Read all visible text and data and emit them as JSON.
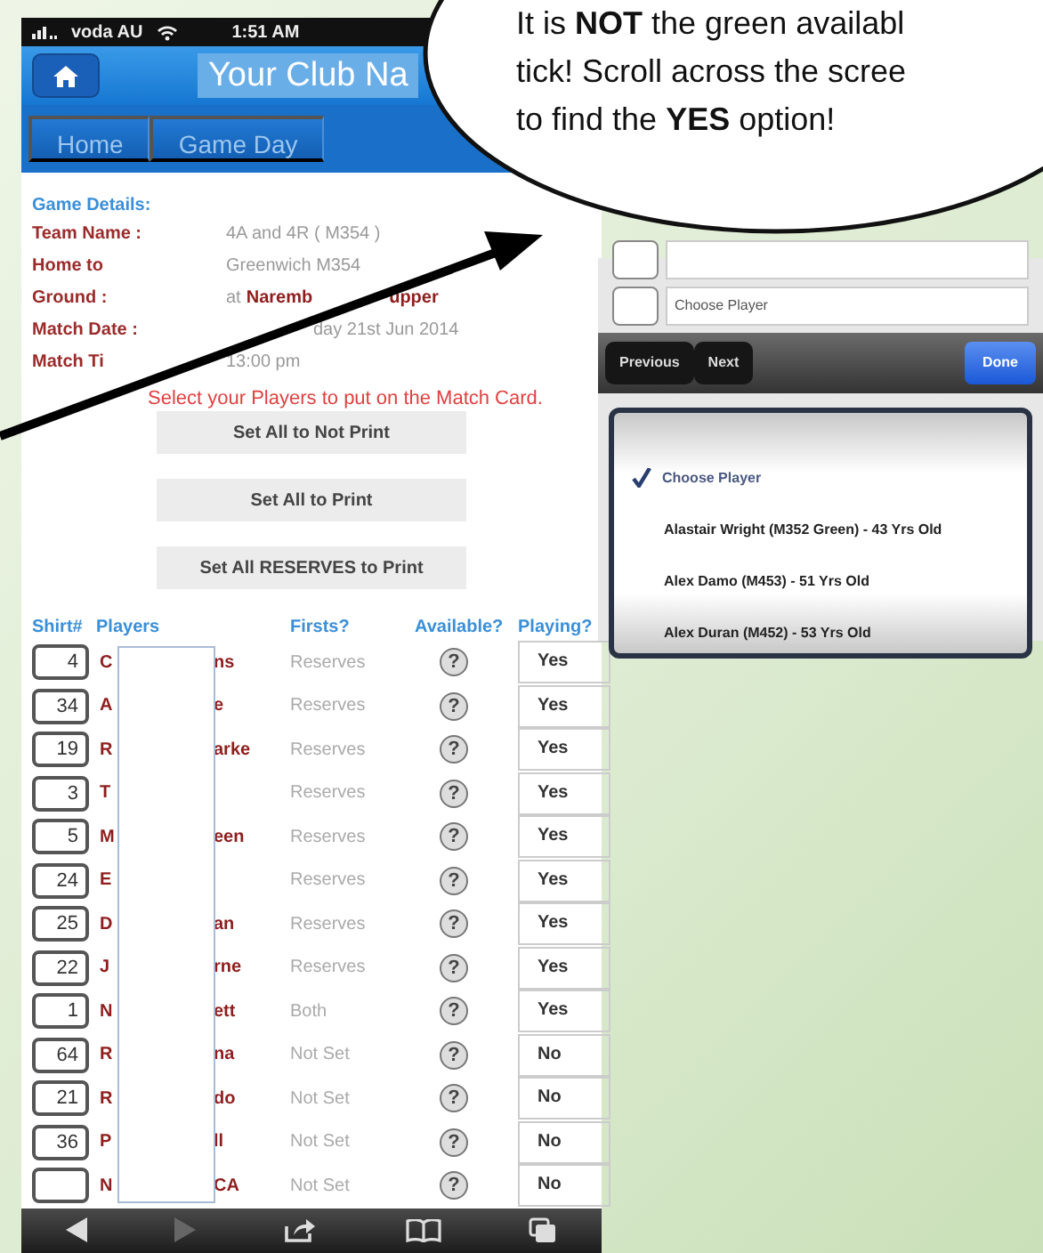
{
  "status_bar": {
    "carrier": "voda AU",
    "time": "1:51 AM"
  },
  "header": {
    "title": "Your Club Na"
  },
  "tabs": [
    {
      "label": "Home"
    },
    {
      "label": "Game Day"
    }
  ],
  "game_details": {
    "heading": "Game Details:",
    "rows": [
      {
        "label": "Team Name :",
        "pieces": [
          {
            "text": "4A and 4R ( M354 )",
            "strong": false
          }
        ]
      },
      {
        "label": "Home to",
        "pieces": [
          {
            "text": "Greenwich M354",
            "strong": false
          }
        ]
      },
      {
        "label": "Ground :",
        "pieces": [
          {
            "text": "at",
            "strong": false
          },
          {
            "text": "Naremb",
            "strong": true
          },
          {
            "text": "upper",
            "strong": true
          }
        ]
      },
      {
        "label": "Match Date :",
        "pieces": [
          {
            "text": "day 21st Jun 2014",
            "strong": false
          }
        ]
      },
      {
        "label": "Match Ti",
        "pieces": [
          {
            "text": "13:00 pm",
            "strong": false
          }
        ]
      }
    ],
    "notice": "Select your Players to put on the Match Card."
  },
  "buttons": [
    "Set All to Not Print",
    "Set All to Print",
    "Set All **RESERVES** to Print"
  ],
  "table": {
    "columns": [
      "Shirt#",
      "Players",
      "Firsts?",
      "Available?",
      "Playing?"
    ],
    "rows": [
      {
        "shirt": "4",
        "name_start": "C",
        "name_end": "ns",
        "firsts": "Reserves",
        "available": "?",
        "playing": "Yes"
      },
      {
        "shirt": "34",
        "name_start": "A",
        "name_end": "e",
        "firsts": "Reserves",
        "available": "?",
        "playing": "Yes"
      },
      {
        "shirt": "19",
        "name_start": "R",
        "name_end": "arke",
        "firsts": "Reserves",
        "available": "?",
        "playing": "Yes"
      },
      {
        "shirt": "3",
        "name_start": "T",
        "firsts": "Reserves",
        "available": "?",
        "playing": "Yes"
      },
      {
        "shirt": "5",
        "name_start": "M",
        "name_end": "een",
        "firsts": "Reserves",
        "available": "?",
        "playing": "Yes"
      },
      {
        "shirt": "24",
        "name_start": "E",
        "firsts": "Reserves",
        "available": "?",
        "playing": "Yes"
      },
      {
        "shirt": "25",
        "name_start": "D",
        "name_end": "an",
        "firsts": "Reserves",
        "available": "?",
        "playing": "Yes"
      },
      {
        "shirt": "22",
        "name_start": "J",
        "name_end": "rne",
        "firsts": "Reserves",
        "available": "?",
        "playing": "Yes"
      },
      {
        "shirt": "1",
        "name_start": "N",
        "name_end": "ett",
        "firsts": "Both",
        "available": "?",
        "playing": "Yes"
      },
      {
        "shirt": "64",
        "name_start": "R",
        "name_end": "na",
        "firsts": "Not Set",
        "available": "?",
        "playing": "No"
      },
      {
        "shirt": "21",
        "name_start": "R",
        "name_end": "do",
        "firsts": "Not Set",
        "available": "?",
        "playing": "No"
      },
      {
        "shirt": "36",
        "name_start": "P",
        "name_end": "ll",
        "firsts": "Not Set",
        "available": "?",
        "playing": "No"
      },
      {
        "name_start": "N",
        "name_end": "CA",
        "firsts": "Not Set",
        "available": "?",
        "playing": "No"
      }
    ]
  },
  "browser_toolbar": {
    "forward_disabled": true
  },
  "callout": {
    "lines": [
      "It is **NOT** the green availabl",
      "tick! Scroll across the scree",
      "to find the **YES** option!"
    ]
  },
  "picker": {
    "fields": [
      {
        "checked": false
      },
      {
        "checked": false,
        "text": "Choose Player"
      }
    ],
    "toolbar": {
      "previous": "Previous",
      "next": "Next",
      "done": "Done"
    },
    "options": [
      {
        "text": "Choose Player",
        "selected": true
      },
      {
        "text": "Alastair Wright (M352 Green) - 43 Yrs Old",
        "selected": false
      },
      {
        "text": "Alex Damo (M453) - 51 Yrs Old",
        "selected": false
      },
      {
        "text": "Alex Duran (M452) - 53 Yrs Old",
        "selected": false
      }
    ]
  }
}
